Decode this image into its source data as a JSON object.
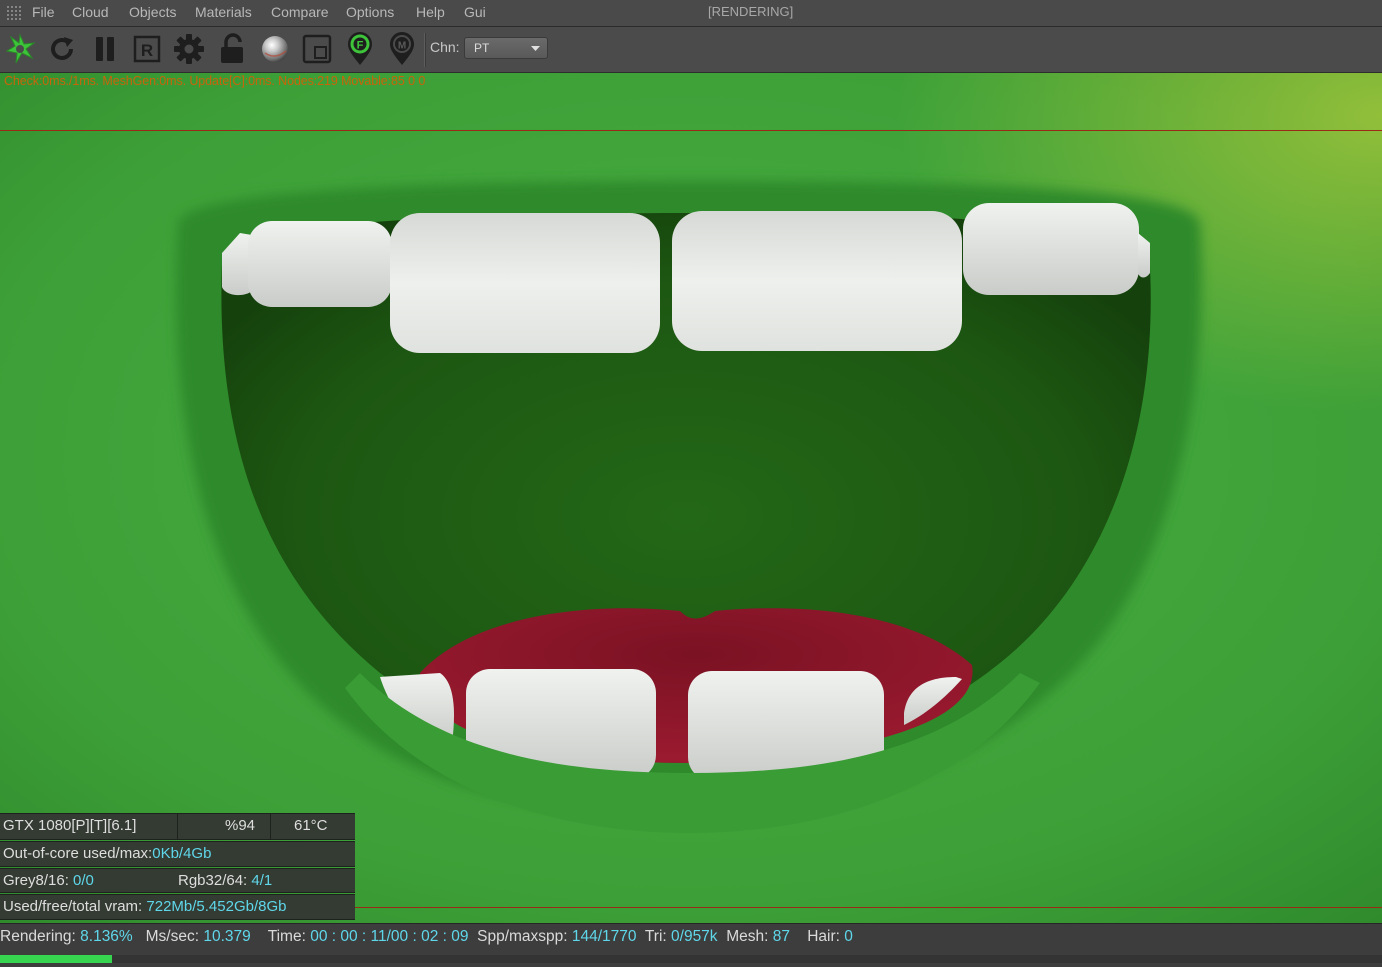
{
  "menu": {
    "items": [
      "File",
      "Cloud",
      "Objects",
      "Materials",
      "Compare",
      "Options",
      "Help",
      "Gui"
    ],
    "window_status": "[RENDERING]"
  },
  "toolbar": {
    "buttons": [
      {
        "name": "octane-logo-icon"
      },
      {
        "name": "restart-render-icon"
      },
      {
        "name": "pause-render-icon"
      },
      {
        "name": "region-render-icon"
      },
      {
        "name": "settings-gear-icon"
      },
      {
        "name": "lock-icon"
      },
      {
        "name": "material-sphere-icon"
      },
      {
        "name": "clay-mode-icon"
      },
      {
        "name": "focus-picker-icon"
      },
      {
        "name": "material-picker-icon"
      }
    ],
    "chn_label": "Chn:",
    "chn_value": "PT",
    "icon_letters": {
      "region": "R",
      "focus": "F",
      "material": "M"
    }
  },
  "viewport": {
    "debug_line": "Check:0ms./1ms. MeshGen:0ms. Update[C]:0ms. Nodes:219 Movable:85  0 0",
    "colors": {
      "skin": "#3fa43a",
      "mouth_inside": "#1f5a14",
      "tongue": "#8a1427",
      "teeth": "#e9ebe8",
      "debug_text": "#c8650c",
      "guide_line": "#9a2a16"
    }
  },
  "gpu_panel": {
    "gpu_name": "GTX 1080[P][T][6.1]",
    "load": "%94",
    "temp": "61°C",
    "out_of_core_label": "Out-of-core used/max:",
    "out_of_core_value": "0Kb/4Gb",
    "grey_label": "Grey8/16: ",
    "grey_value": "0/0",
    "rgb_label": "Rgb32/64: ",
    "rgb_value": "4/1",
    "vram_label": "Used/free/total vram: ",
    "vram_value": "722Mb/5.452Gb/8Gb"
  },
  "status": {
    "rendering_label": "Rendering: ",
    "rendering_value": "8.136%",
    "ms_label": "Ms/sec: ",
    "ms_value": "10.379",
    "time_label": "Time: ",
    "time_value": "00 : 00 : 11/00 : 02 : 09",
    "spp_label": "Spp/maxspp: ",
    "spp_value": "144/1770",
    "tri_label": "Tri: ",
    "tri_value": "0/957k",
    "mesh_label": "Mesh: ",
    "mesh_value": "87",
    "hair_label": "Hair: ",
    "hair_value": "0",
    "progress_fraction": 0.08136,
    "progress_color": "#36d44f"
  }
}
